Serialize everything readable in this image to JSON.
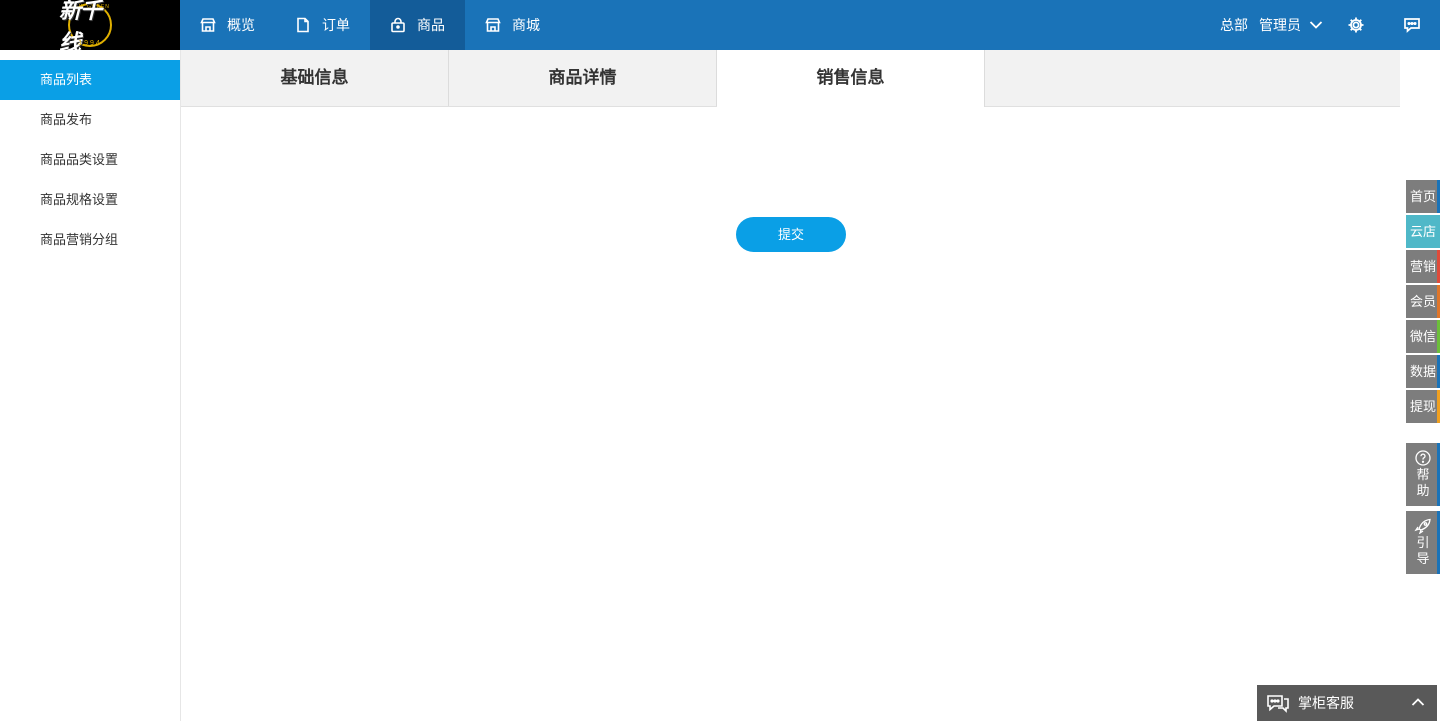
{
  "logo": {
    "text": "新千线",
    "sub": "NEW GREEN",
    "year": "1994"
  },
  "nav": [
    {
      "label": "概览",
      "icon": "store-icon"
    },
    {
      "label": "订单",
      "icon": "file-icon"
    },
    {
      "label": "商品",
      "icon": "bag-icon",
      "active": true
    },
    {
      "label": "商城",
      "icon": "shop-icon"
    }
  ],
  "header": {
    "org": "总部",
    "user": "管理员"
  },
  "sidebar": {
    "items": [
      {
        "label": "商品列表",
        "active": true
      },
      {
        "label": "商品发布"
      },
      {
        "label": "商品品类设置"
      },
      {
        "label": "商品规格设置"
      },
      {
        "label": "商品营销分组"
      }
    ]
  },
  "tabs": [
    {
      "label": "基础信息"
    },
    {
      "label": "商品详情"
    },
    {
      "label": "销售信息",
      "active": true
    }
  ],
  "form": {
    "submit_label": "提交"
  },
  "float_bar": {
    "items": [
      {
        "label": "首页",
        "edge": "#1a73b8"
      },
      {
        "label": "云店",
        "edge": "#4fb8c8"
      },
      {
        "label": "营销",
        "edge": "#e04b3a"
      },
      {
        "label": "会员",
        "edge": "#e0762a"
      },
      {
        "label": "微信",
        "edge": "#6cbf3a"
      },
      {
        "label": "数据",
        "edge": "#1a73b8"
      },
      {
        "label": "提现",
        "edge": "#f0a020"
      }
    ],
    "help": {
      "line1": "帮",
      "line2": "助"
    },
    "guide": {
      "line1": "引",
      "line2": "导"
    }
  },
  "chat": {
    "label": "掌柜客服"
  },
  "colors": {
    "topbar": "#1a73b8",
    "accent": "#0a9fe6",
    "active_nav": "#135c99"
  }
}
